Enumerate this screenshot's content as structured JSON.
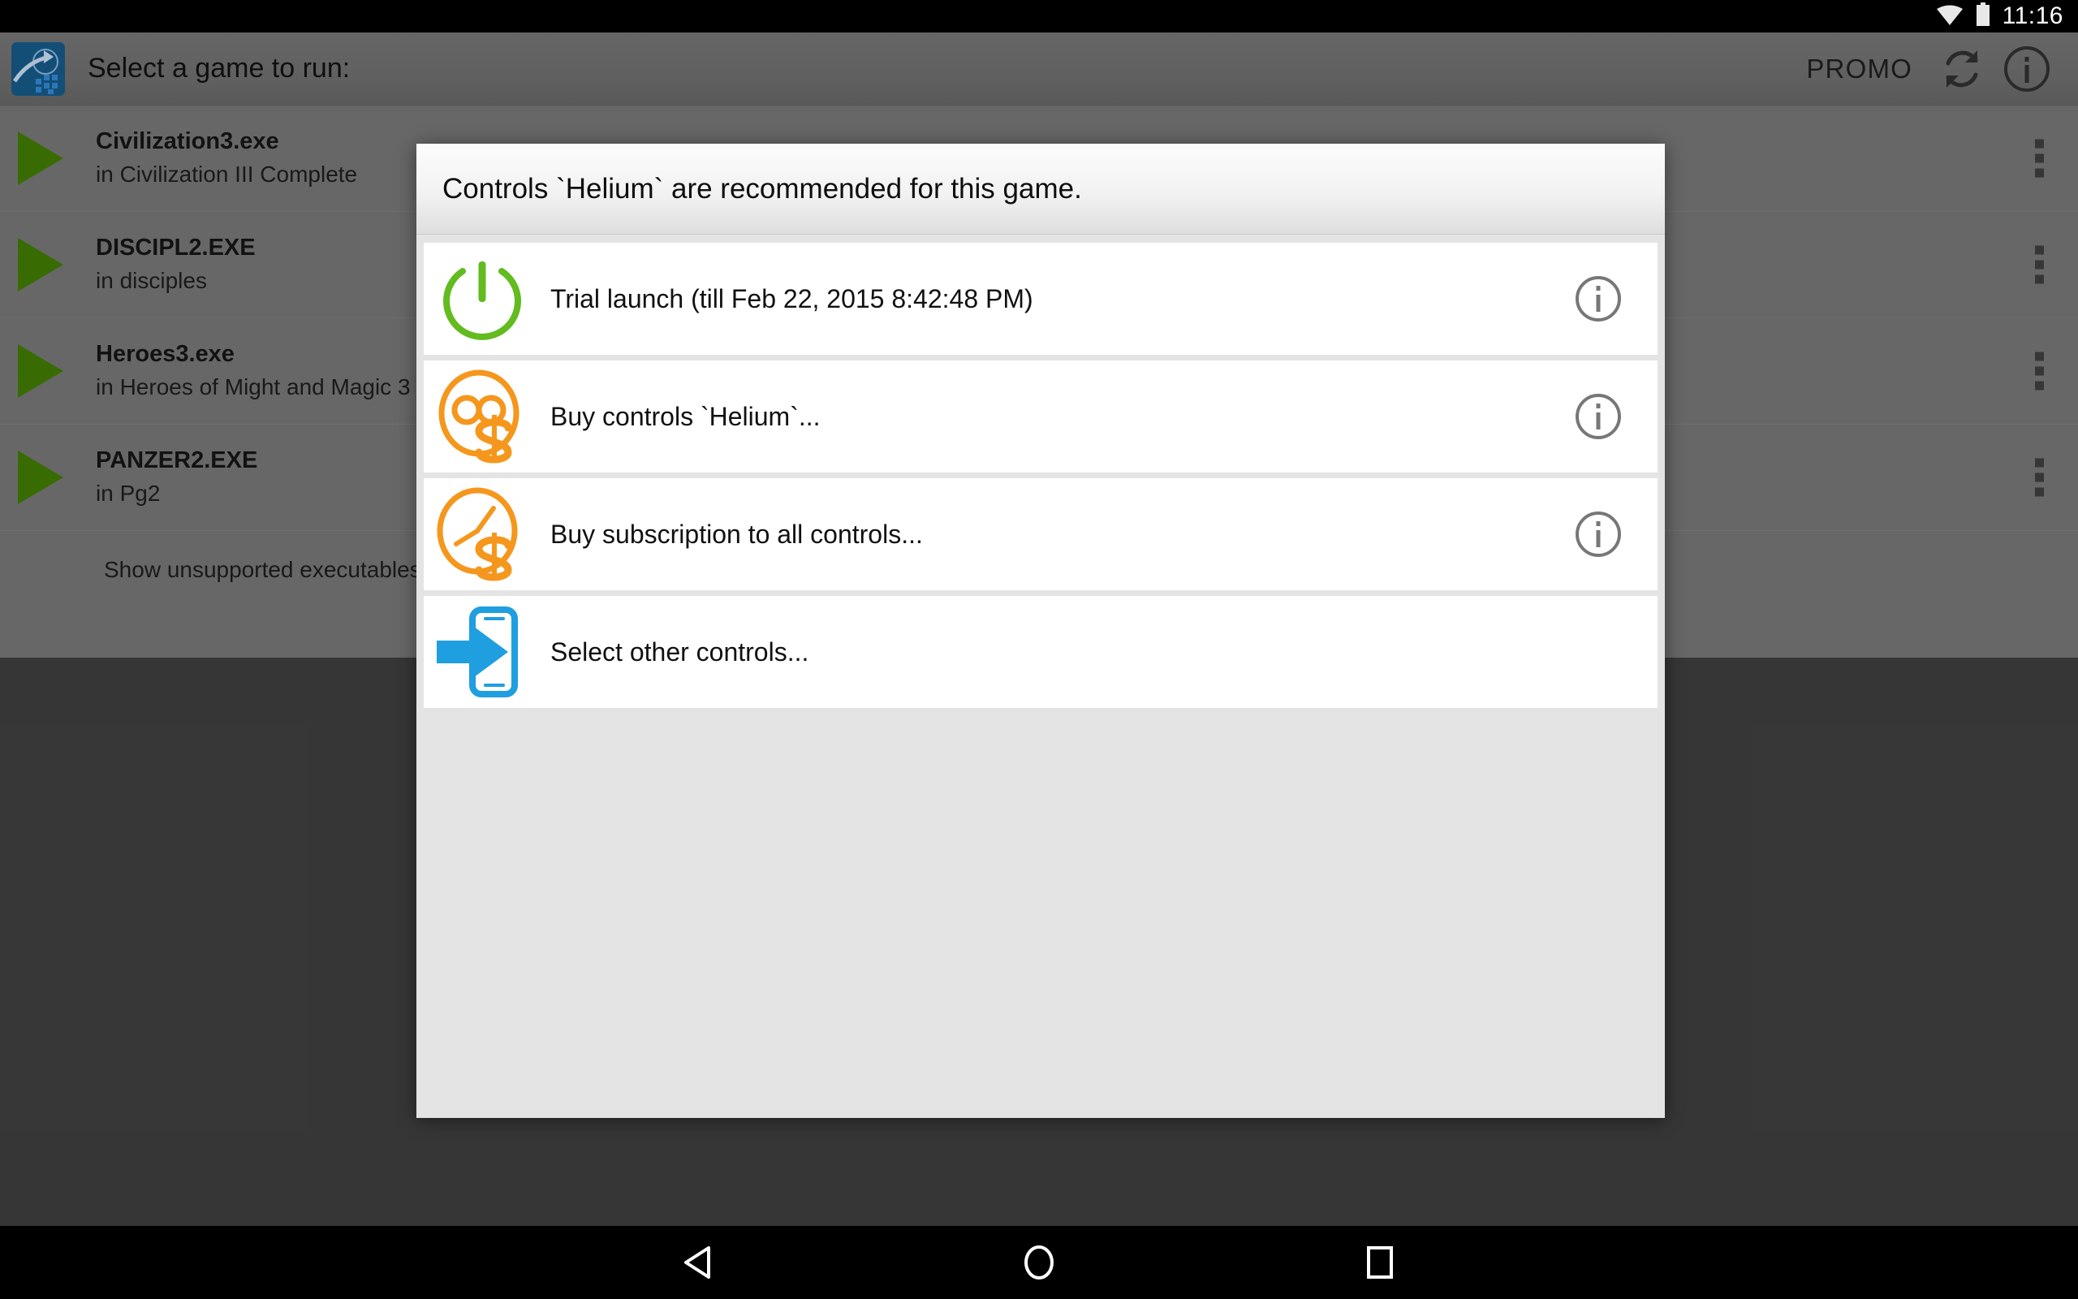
{
  "status_bar": {
    "time": "11:16",
    "icons": [
      "wifi-icon",
      "battery-icon"
    ]
  },
  "action_bar": {
    "app_icon": "app-logo-icon",
    "title": "Select a game to run:",
    "promo_label": "PROMO",
    "refresh_icon": "refresh-icon",
    "info_icon": "info-icon"
  },
  "game_list": {
    "items": [
      {
        "name": "Civilization3.exe",
        "location": "in Civilization III Complete",
        "play_icon": "play-icon",
        "overflow_icon": "overflow-menu-icon"
      },
      {
        "name": "DISCIPL2.EXE",
        "location": "in disciples",
        "play_icon": "play-icon",
        "overflow_icon": "overflow-menu-icon"
      },
      {
        "name": "Heroes3.exe",
        "location": "in Heroes of Might and Magic 3",
        "play_icon": "play-icon",
        "overflow_icon": "overflow-menu-icon"
      },
      {
        "name": "PANZER2.EXE",
        "location": "in Pg2",
        "play_icon": "play-icon",
        "overflow_icon": "overflow-menu-icon"
      }
    ],
    "show_unsupported_label": "Show unsupported executables"
  },
  "dialog": {
    "title": "Controls `Helium` are recommended for this game.",
    "options": [
      {
        "label": "Trial launch (till Feb 22, 2015 8:42:48 PM)",
        "icon": "power-icon",
        "icon_color": "#62bb1f",
        "has_info": true,
        "info_icon": "info-icon"
      },
      {
        "label": "Buy controls `Helium`...",
        "icon": "infinity-dollar-icon",
        "icon_color": "#f5971d",
        "has_info": true,
        "info_icon": "info-icon"
      },
      {
        "label": "Buy subscription to all controls...",
        "icon": "clock-dollar-icon",
        "icon_color": "#f5971d",
        "has_info": true,
        "info_icon": "info-icon"
      },
      {
        "label": "Select other controls...",
        "icon": "phone-arrow-in-icon",
        "icon_color": "#1f9ee0",
        "has_info": false,
        "info_icon": ""
      }
    ]
  },
  "nav_bar": {
    "back_icon": "back-triangle-icon",
    "home_icon": "home-circle-icon",
    "recents_icon": "recents-square-icon"
  },
  "colors": {
    "accent_green": "#62bb1f",
    "accent_orange": "#f5971d",
    "accent_blue": "#1f9ee0",
    "play_green": "#3c7304",
    "background_gray": "#6e6e6e"
  }
}
